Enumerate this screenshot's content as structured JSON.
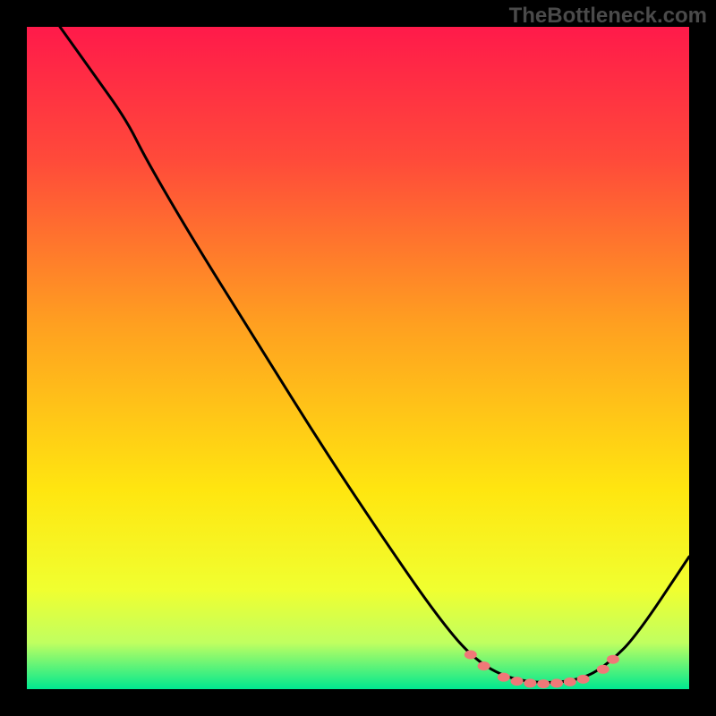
{
  "watermark": "TheBottleneck.com",
  "chart_data": {
    "type": "line",
    "title": "",
    "xlabel": "",
    "ylabel": "",
    "xlim": [
      0,
      100
    ],
    "ylim": [
      0,
      100
    ],
    "grid": false,
    "legend": false,
    "gradient_stops": [
      {
        "offset": 0,
        "color": "#ff1a4a"
      },
      {
        "offset": 20,
        "color": "#ff4a3a"
      },
      {
        "offset": 45,
        "color": "#ffa020"
      },
      {
        "offset": 70,
        "color": "#ffe610"
      },
      {
        "offset": 85,
        "color": "#f0ff30"
      },
      {
        "offset": 93,
        "color": "#c0ff60"
      },
      {
        "offset": 100,
        "color": "#00e890"
      }
    ],
    "curve": [
      {
        "x": 5,
        "y": 100
      },
      {
        "x": 10,
        "y": 93
      },
      {
        "x": 15,
        "y": 86
      },
      {
        "x": 18,
        "y": 80
      },
      {
        "x": 25,
        "y": 68
      },
      {
        "x": 35,
        "y": 52
      },
      {
        "x": 45,
        "y": 36
      },
      {
        "x": 55,
        "y": 21
      },
      {
        "x": 62,
        "y": 11
      },
      {
        "x": 67,
        "y": 5
      },
      {
        "x": 72,
        "y": 1.8
      },
      {
        "x": 78,
        "y": 0.8
      },
      {
        "x": 84,
        "y": 1.5
      },
      {
        "x": 88,
        "y": 4
      },
      {
        "x": 92,
        "y": 8
      },
      {
        "x": 100,
        "y": 20
      }
    ],
    "markers": [
      {
        "x": 67,
        "y": 5.2
      },
      {
        "x": 69,
        "y": 3.5
      },
      {
        "x": 72,
        "y": 1.8
      },
      {
        "x": 74,
        "y": 1.2
      },
      {
        "x": 76,
        "y": 0.9
      },
      {
        "x": 78,
        "y": 0.8
      },
      {
        "x": 80,
        "y": 0.9
      },
      {
        "x": 82,
        "y": 1.1
      },
      {
        "x": 84,
        "y": 1.5
      },
      {
        "x": 87,
        "y": 3.0
      },
      {
        "x": 88.5,
        "y": 4.5
      }
    ],
    "marker_color": "#f07878",
    "curve_color": "#000000"
  }
}
